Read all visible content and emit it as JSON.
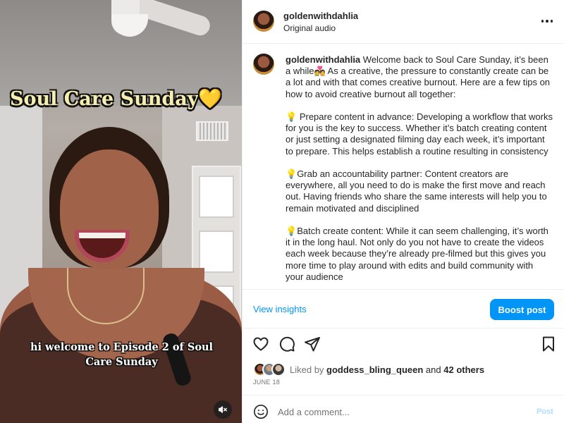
{
  "video": {
    "title_text": "Soul Care Sunday",
    "title_emoji": "💛",
    "subtitle": "hi welcome to Episode 2 of Soul Care Sunday",
    "mute_icon": "volume-muted-icon"
  },
  "header": {
    "username": "goldenwithdahlia",
    "audio": "Original audio",
    "more_icon": "more-horizontal-icon"
  },
  "caption": {
    "username": "goldenwithdahlia",
    "intro": "Welcome back to Soul Care Sunday, it’s been a while💑 As a creative, the pressure to constantly create can be a lot and with that comes creative burnout. Here are a few tips on how to avoid creative burnout all together:",
    "tip_icon": "💡",
    "tips": [
      " Prepare content in advance: Developing a workflow that works for you is the key to success. Whether it’s batch creating content or just setting a designated filming day each week, it’s important to prepare. This helps establish a routine resulting in consistency",
      "Grab an accountability partner: Content creators are everywhere, all you need to do is make the first move and reach out. Having friends who share the same interests will help you to remain motivated and disciplined",
      "Batch create content: While it can seem challenging, it’s worth it in the long haul. Not only do you not have to create the videos each week because they’re already pre-filmed but this gives you more time to play around with edits and build community with your audience"
    ]
  },
  "insights": {
    "view_label": "View insights",
    "boost_label": "Boost post"
  },
  "actions": {
    "like_icon": "heart-icon",
    "comment_icon": "comment-icon",
    "share_icon": "share-icon",
    "save_icon": "bookmark-icon"
  },
  "likes": {
    "prefix": "Liked by",
    "user": "goddess_bling_queen",
    "joiner": "and",
    "others": "42 others"
  },
  "date": "JUNE 18",
  "comment": {
    "placeholder": "Add a comment...",
    "post_label": "Post",
    "emoji_icon": "emoji-icon"
  }
}
